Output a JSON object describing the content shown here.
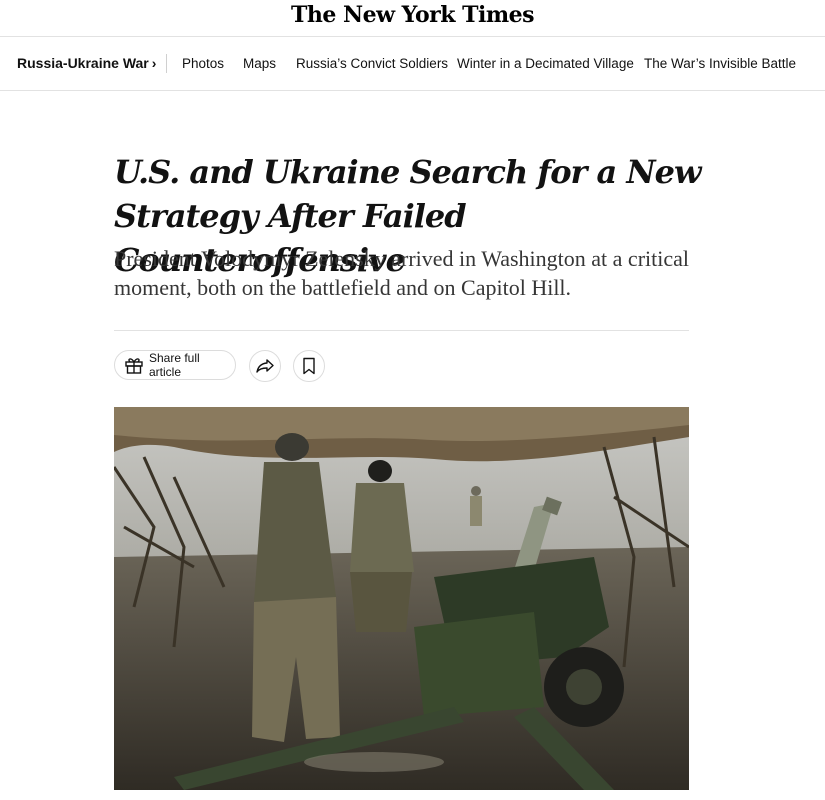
{
  "masthead": {
    "title": "The New York Times"
  },
  "nav": {
    "section": "Russia-Ukraine War",
    "section_chevron": "›",
    "links": [
      "Photos",
      "Maps",
      "Russia’s Convict Soldiers",
      "Winter in a Decimated Village",
      "The War’s Invisible Battle"
    ]
  },
  "article": {
    "headline": "U.S. and Ukraine Search for a New Strategy After Failed Counteroffensive",
    "summary": "President Volodymyr Zelensky arrived in Washington at a critical moment, both on the battlefield and on Capitol Hill.",
    "share_label": "Share full article"
  },
  "icons": {
    "share": "gift-icon",
    "forward": "share-arrow-icon",
    "save": "bookmark-icon"
  },
  "colors": {
    "text": "#121212",
    "subtext": "#363636",
    "rule": "#e2e2e2"
  }
}
